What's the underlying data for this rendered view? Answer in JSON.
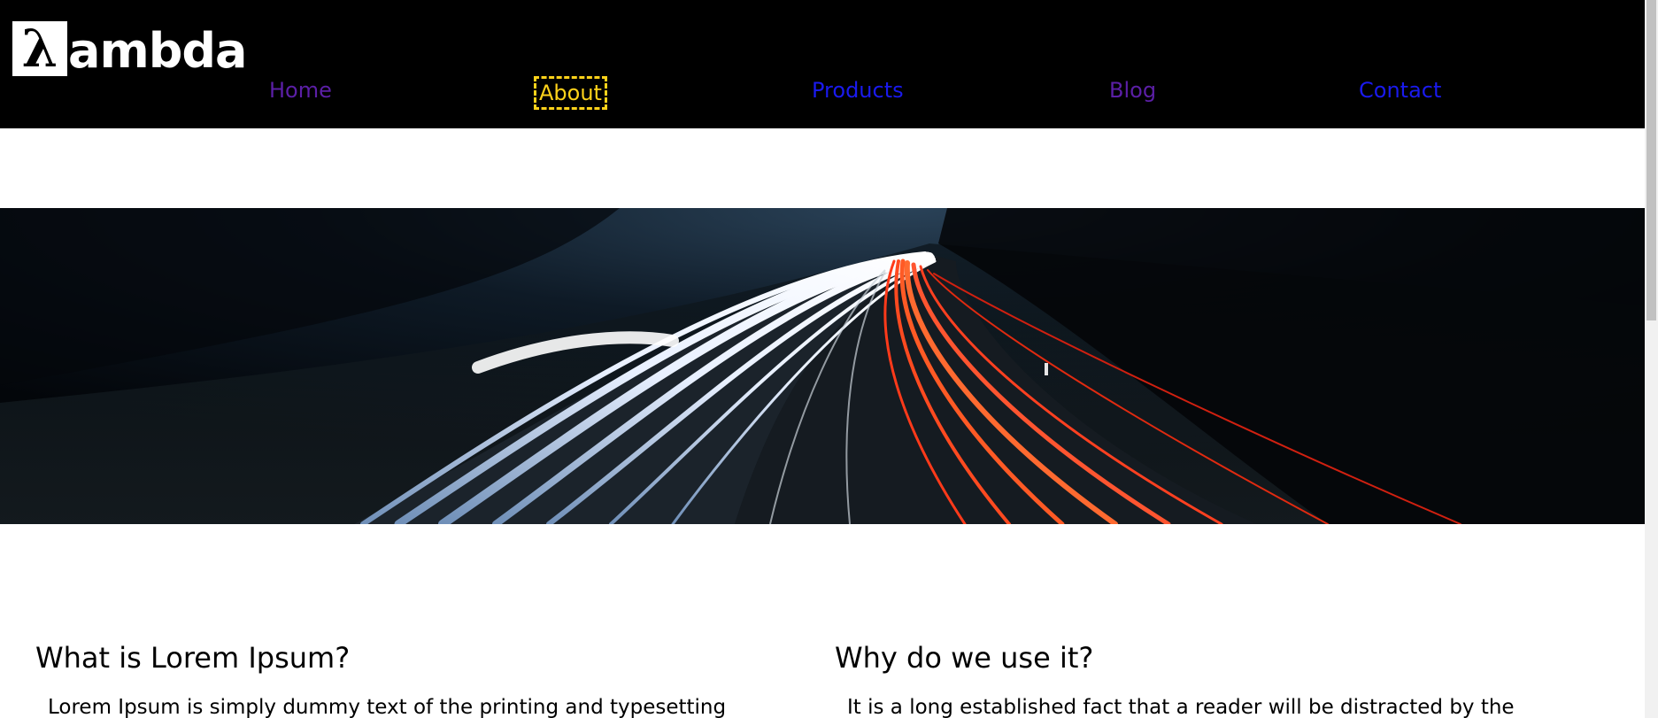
{
  "brand": {
    "mark": "λ",
    "text": "ambda"
  },
  "nav": {
    "items": [
      {
        "label": "Home",
        "color": "#5b1fa6"
      },
      {
        "label": "About",
        "color": "#ffd21a",
        "focused": true
      },
      {
        "label": "Products",
        "color": "#1a1aee"
      },
      {
        "label": "Blog",
        "color": "#5b1fa6"
      },
      {
        "label": "Contact",
        "color": "#1a1aee"
      }
    ]
  },
  "hero": {
    "image": "highway-night-light-trails"
  },
  "sections": [
    {
      "heading": "What is Lorem Ipsum?",
      "text": "Lorem Ipsum is simply dummy text of the printing and typesetting"
    },
    {
      "heading": "Why do we use it?",
      "text": "It is a long established fact that a reader will be distracted by the"
    }
  ],
  "colors": {
    "header_bg": "#000000",
    "focus_outline": "#ffd21a"
  }
}
